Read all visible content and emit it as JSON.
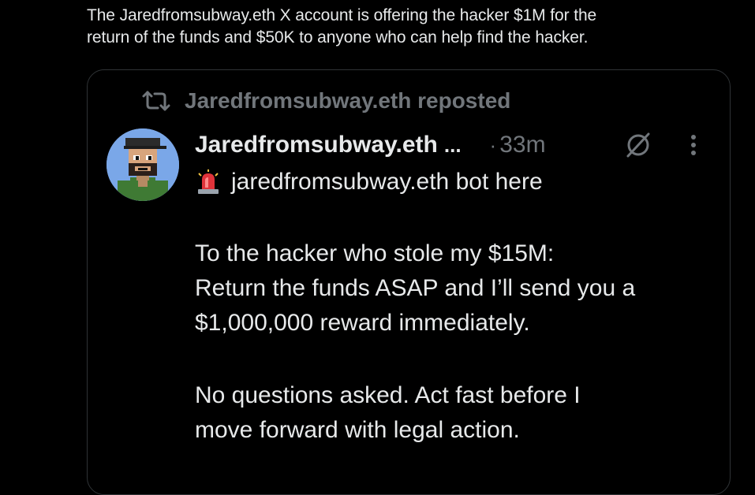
{
  "caption": {
    "line1": "The Jaredfromsubway.eth X account is offering the hacker $1M for the",
    "line2": "return of the funds and $50K to anyone who can help find the hacker."
  },
  "embedded_post": {
    "repost_label": "Jaredfromsubway.eth reposted",
    "author": {
      "display_name": "Jaredfromsubway.eth",
      "truncation": "...",
      "separator": "·",
      "timestamp": "33m",
      "avatar_icon": "pixel-art-avatar-icon"
    },
    "icons": {
      "repost": "repost-icon",
      "grok": "grok-icon",
      "more": "more-options-icon",
      "siren": "police-light-emoji-icon"
    },
    "bot_line": "jaredfromsubway.eth bot here",
    "paragraph1": [
      "To the hacker who stole my $15M:",
      "Return the funds ASAP and I’ll send you a",
      "$1,000,000 reward immediately."
    ],
    "paragraph2": [
      "No questions asked. Act fast before I",
      "move forward with legal action."
    ]
  },
  "colors": {
    "background": "#000000",
    "text_primary": "#e7e9ea",
    "text_secondary": "#71767b",
    "card_border": "#2f3336",
    "avatar_bg": "#7aa7e8"
  }
}
